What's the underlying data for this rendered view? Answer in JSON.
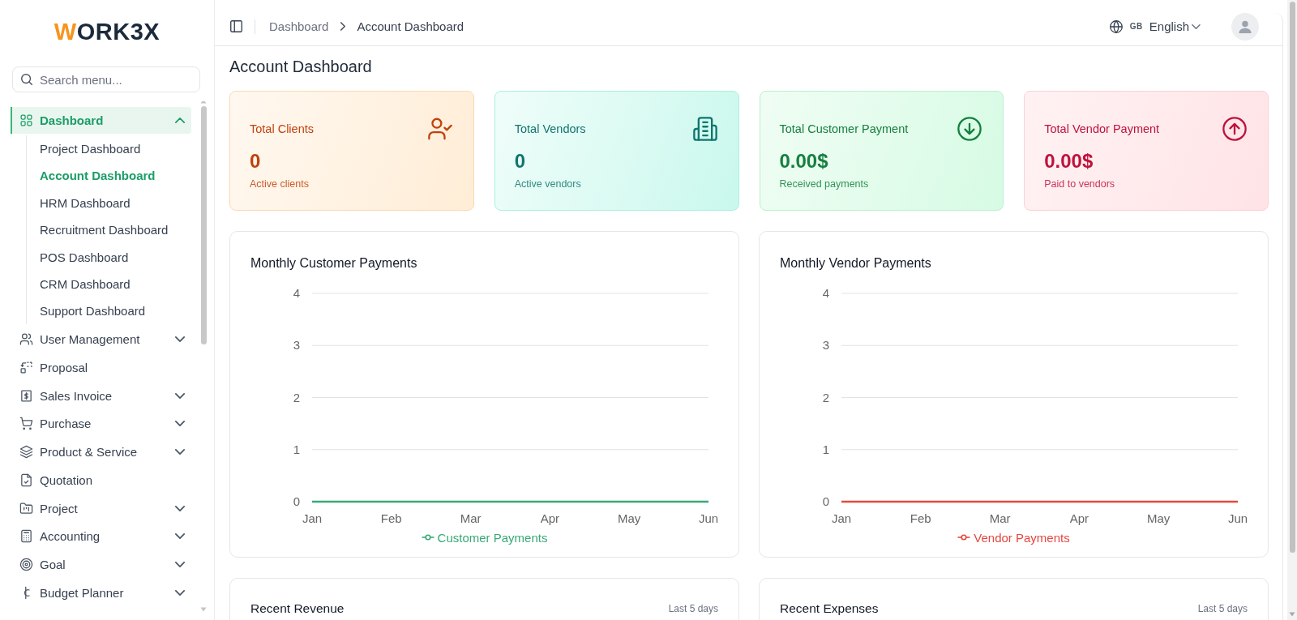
{
  "sidebar": {
    "logo": "WORK3X",
    "search": {
      "placeholder": "Search menu..."
    },
    "items": [
      {
        "label": "Dashboard",
        "kind": "group",
        "selected": true,
        "expanded": true,
        "children": [
          {
            "label": "Project Dashboard",
            "selected": false
          },
          {
            "label": "Account Dashboard",
            "selected": true
          },
          {
            "label": "HRM Dashboard",
            "selected": false
          },
          {
            "label": "Recruitment Dashboard",
            "selected": false
          },
          {
            "label": "POS Dashboard",
            "selected": false
          },
          {
            "label": "CRM Dashboard",
            "selected": false
          },
          {
            "label": "Support Dashboard",
            "selected": false
          }
        ]
      },
      {
        "label": "User Management",
        "kind": "group",
        "selected": false,
        "expanded": false
      },
      {
        "label": "Proposal",
        "kind": "link",
        "selected": false
      },
      {
        "label": "Sales Invoice",
        "kind": "group",
        "selected": false,
        "expanded": false
      },
      {
        "label": "Purchase",
        "kind": "group",
        "selected": false,
        "expanded": false
      },
      {
        "label": "Product & Service",
        "kind": "group",
        "selected": false,
        "expanded": false
      },
      {
        "label": "Quotation",
        "kind": "link",
        "selected": false
      },
      {
        "label": "Project",
        "kind": "group",
        "selected": false,
        "expanded": false
      },
      {
        "label": "Accounting",
        "kind": "group",
        "selected": false,
        "expanded": false
      },
      {
        "label": "Goal",
        "kind": "group",
        "selected": false,
        "expanded": false
      },
      {
        "label": "Budget Planner",
        "kind": "group",
        "selected": false,
        "expanded": false
      }
    ]
  },
  "header": {
    "breadcrumb": [
      "Dashboard",
      "Account Dashboard"
    ],
    "language": {
      "code": "GB",
      "label": "English"
    }
  },
  "page_title": "Account Dashboard",
  "stat_cards": [
    {
      "kind": "clients",
      "title": "Total Clients",
      "value": "0",
      "caption": "Active clients",
      "color": "#c2410c"
    },
    {
      "kind": "vendors",
      "title": "Total Vendors",
      "value": "0",
      "caption": "Active vendors",
      "color": "#0f766e"
    },
    {
      "kind": "customer_payment",
      "title": "Total Customer Payment",
      "value": "0.00$",
      "caption": "Received payments",
      "color": "#15803d"
    },
    {
      "kind": "vendor_payment",
      "title": "Total Vendor Payment",
      "value": "0.00$",
      "caption": "Paid to vendors",
      "color": "#be123c"
    }
  ],
  "charts": [
    {
      "chart_data": {
        "type": "line",
        "title": "Monthly Customer Payments",
        "categories": [
          "Jan",
          "Feb",
          "Mar",
          "Apr",
          "May",
          "Jun"
        ],
        "series": [
          {
            "name": "Customer Payments",
            "color": "#3aa876",
            "values": [
              0,
              0,
              0,
              0,
              0,
              0
            ]
          }
        ],
        "ylim": [
          0,
          4
        ],
        "yticks": [
          0,
          1,
          2,
          3,
          4
        ],
        "grid": true
      }
    },
    {
      "chart_data": {
        "type": "line",
        "title": "Monthly Vendor Payments",
        "categories": [
          "Jan",
          "Feb",
          "Mar",
          "Apr",
          "May",
          "Jun"
        ],
        "series": [
          {
            "name": "Vendor Payments",
            "color": "#e5483f",
            "values": [
              0,
              0,
              0,
              0,
              0,
              0
            ]
          }
        ],
        "ylim": [
          0,
          4
        ],
        "yticks": [
          0,
          1,
          2,
          3,
          4
        ],
        "grid": true
      }
    }
  ],
  "recent_panels": [
    {
      "title": "Recent Revenue",
      "period": "Last 5 days"
    },
    {
      "title": "Recent Expenses",
      "period": "Last 5 days"
    }
  ]
}
